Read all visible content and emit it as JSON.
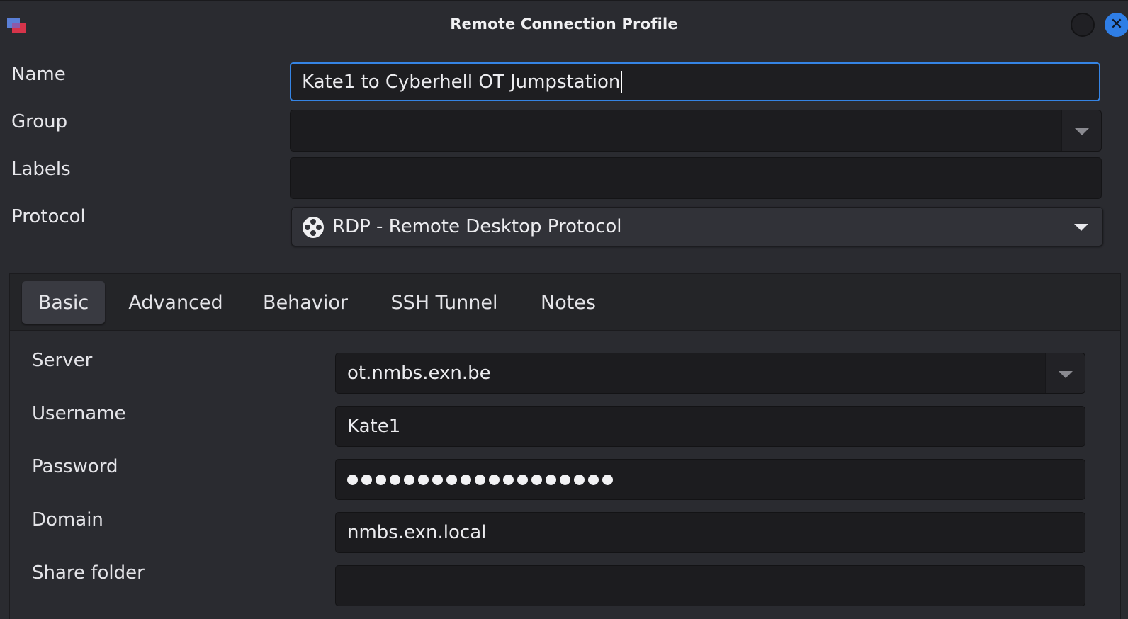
{
  "window": {
    "title": "Remote Connection Profile",
    "app_icon": "remmina-app-icon",
    "controls": [
      "minimize-button",
      "close-button"
    ],
    "close_glyph": "✕",
    "accent_color": "#3584e4"
  },
  "profile": {
    "name": {
      "label": "Name",
      "value": "Kate1 to Cyberhell OT Jumpstation"
    },
    "group": {
      "label": "Group",
      "value": ""
    },
    "labels": {
      "label": "Labels",
      "value": ""
    },
    "protocol": {
      "label": "Protocol",
      "value": "RDP - Remote Desktop Protocol",
      "icon": "rdp-protocol-icon"
    }
  },
  "tabs": [
    {
      "label": "Basic",
      "active": true
    },
    {
      "label": "Advanced",
      "active": false
    },
    {
      "label": "Behavior",
      "active": false
    },
    {
      "label": "SSH Tunnel",
      "active": false
    },
    {
      "label": "Notes",
      "active": false
    }
  ],
  "basic": {
    "server": {
      "label": "Server",
      "value": "ot.nmbs.exn.be"
    },
    "username": {
      "label": "Username",
      "value": "Kate1"
    },
    "password": {
      "label": "Password",
      "mask_count": 19
    },
    "domain": {
      "label": "Domain",
      "value": "nmbs.exn.local"
    },
    "share_folder": {
      "label": "Share folder",
      "value": ""
    }
  }
}
